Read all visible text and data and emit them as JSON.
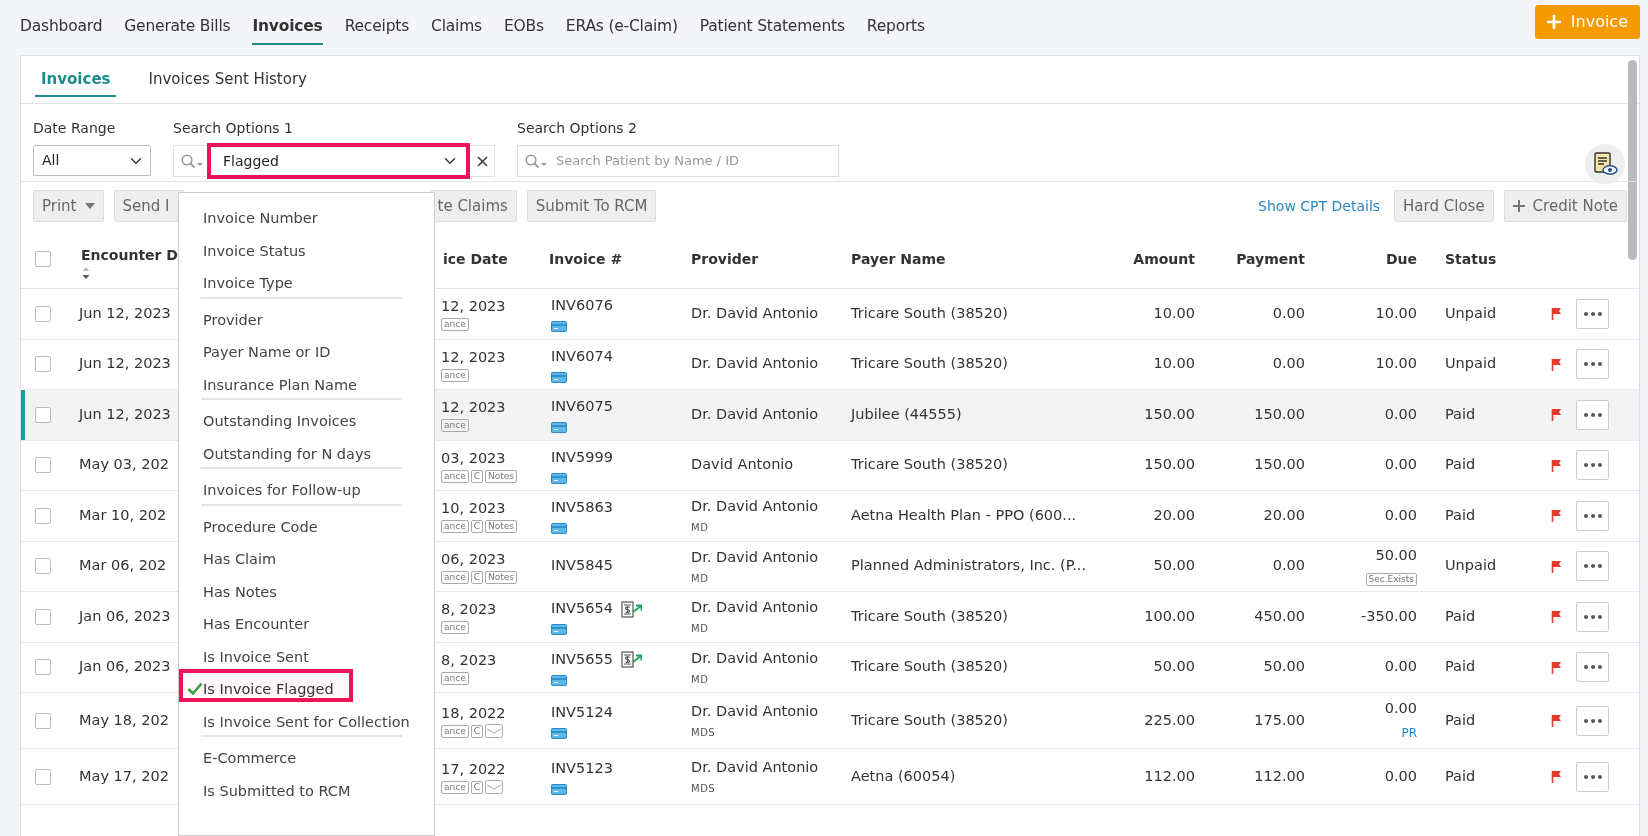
{
  "nav": {
    "tabs": [
      {
        "label": "Dashboard",
        "selected": false
      },
      {
        "label": "Generate Bills",
        "selected": false
      },
      {
        "label": "Invoices",
        "selected": true
      },
      {
        "label": "Receipts",
        "selected": false
      },
      {
        "label": "Claims",
        "selected": false
      },
      {
        "label": "EOBs",
        "selected": false
      },
      {
        "label": "ERAs (e-Claim)",
        "selected": false
      },
      {
        "label": "Patient Statements",
        "selected": false
      },
      {
        "label": "Reports",
        "selected": false
      }
    ],
    "new_button": "Invoice"
  },
  "subtabs": [
    {
      "label": "Invoices",
      "selected": true
    },
    {
      "label": "Invoices Sent History",
      "selected": false
    }
  ],
  "filters": {
    "date_range": {
      "label": "Date Range",
      "value": "All"
    },
    "search1": {
      "label": "Search Options 1",
      "value": "Flagged",
      "highlighted": true
    },
    "search2": {
      "label": "Search Options 2",
      "placeholder": "Search Patient by Name / ID"
    }
  },
  "toolbar": {
    "left": [
      {
        "label": "Print",
        "kind": "dropdown"
      },
      {
        "label": "Send I",
        "kind": "button"
      },
      {
        "label": "te Claims",
        "kind": "button"
      },
      {
        "label": "Submit To RCM",
        "kind": "button"
      }
    ],
    "link": "Show CPT Details",
    "right": [
      {
        "label": "Hard Close",
        "kind": "button"
      },
      {
        "label": "Credit Note",
        "kind": "add"
      }
    ]
  },
  "table": {
    "select_all_checked": false,
    "columns": [
      "Encounter D",
      "ice Date",
      "Invoice #",
      "Provider",
      "Payer Name",
      "Amount",
      "Payment",
      "Due",
      "Status"
    ],
    "rows": [
      {
        "selected": false,
        "checked": false,
        "encounter": "Jun 12, 2023",
        "invoice_date": "12, 2023",
        "tags": [
          "ance"
        ],
        "mail": false,
        "invoice": "INV6076",
        "card": true,
        "sent": false,
        "provider": "Dr. David Antonio",
        "amount": "10.00",
        "payment": "0.00",
        "payer": "Tricare South (38520)",
        "due": "10.00",
        "status": "Unpaid",
        "flagged": true
      },
      {
        "selected": false,
        "checked": false,
        "encounter": "Jun 12, 2023",
        "invoice_date": "12, 2023",
        "tags": [
          "ance"
        ],
        "mail": false,
        "invoice": "INV6074",
        "card": true,
        "sent": false,
        "provider": "Dr. David Antonio",
        "amount": "10.00",
        "payment": "0.00",
        "payer": "Tricare South (38520)",
        "due": "10.00",
        "status": "Unpaid",
        "flagged": true
      },
      {
        "selected": true,
        "checked": false,
        "encounter": "Jun 12, 2023",
        "invoice_date": "12, 2023",
        "tags": [
          "ance"
        ],
        "mail": false,
        "invoice": "INV6075",
        "card": true,
        "sent": false,
        "provider": "Dr. David Antonio",
        "amount": "150.00",
        "payment": "150.00",
        "payer": "Jubilee (44555)",
        "due": "0.00",
        "status": "Paid",
        "flagged": true
      },
      {
        "selected": false,
        "checked": false,
        "encounter": "May 03, 202",
        "invoice_date": "03, 2023",
        "tags": [
          "ance",
          "C",
          "Notes"
        ],
        "mail": false,
        "invoice": "INV5999",
        "card": true,
        "sent": false,
        "provider": "David Antonio",
        "amount": "150.00",
        "payment": "150.00",
        "payer": "Tricare South (38520)",
        "due": "0.00",
        "status": "Paid",
        "flagged": true
      },
      {
        "selected": false,
        "checked": false,
        "encounter": "Mar 10, 202",
        "invoice_date": "10, 2023",
        "tags": [
          "ance",
          "C",
          "Notes"
        ],
        "mail": false,
        "invoice": "INV5863",
        "card": true,
        "sent": false,
        "provider": "Dr. David Antonio",
        "provider_suffix": "MD",
        "amount": "20.00",
        "payment": "20.00",
        "payer": "Aetna Health Plan - PPO (600...",
        "due": "0.00",
        "status": "Paid",
        "flagged": true
      },
      {
        "selected": false,
        "checked": false,
        "encounter": "Mar 06, 202",
        "invoice_date": "06, 2023",
        "tags": [
          "ance",
          "C",
          "Notes"
        ],
        "mail": false,
        "invoice": "INV5845",
        "card": false,
        "sent": false,
        "provider": "Dr. David Antonio",
        "provider_suffix": "MD",
        "amount": "50.00",
        "payment": "0.00",
        "payer": "Planned Administrators, Inc. (P...",
        "due": "50.00",
        "due_note": {
          "kind": "tag",
          "text": "Sec.Exists"
        },
        "status": "Unpaid",
        "flagged": true
      },
      {
        "selected": false,
        "checked": false,
        "encounter": "Jan 06, 2023",
        "invoice_date": "8, 2023",
        "tags": [
          "ance"
        ],
        "mail": false,
        "invoice": "INV5654",
        "card": true,
        "sent": true,
        "provider": "Dr. David Antonio",
        "provider_suffix": "MD",
        "amount": "100.00",
        "payment": "450.00",
        "payer": "Tricare South (38520)",
        "due": "-350.00",
        "status": "Paid",
        "flagged": true
      },
      {
        "selected": false,
        "checked": false,
        "encounter": "Jan 06, 2023",
        "invoice_date": "8, 2023",
        "tags": [
          "ance"
        ],
        "mail": false,
        "invoice": "INV5655",
        "card": true,
        "sent": true,
        "provider": "Dr. David Antonio",
        "provider_suffix": "MD",
        "amount": "50.00",
        "payment": "50.00",
        "payer": "Tricare South (38520)",
        "due": "0.00",
        "status": "Paid",
        "flagged": true
      },
      {
        "selected": false,
        "checked": false,
        "encounter": "May 18, 202",
        "invoice_date": "18, 2022",
        "tags": [
          "ance",
          "C"
        ],
        "mail": true,
        "invoice": "INV5124",
        "card": true,
        "sent": false,
        "provider": "Dr. David Antonio",
        "provider_suffix": "MDS",
        "amount": "225.00",
        "payment": "175.00",
        "payer": "Tricare South (38520)",
        "due": "0.00",
        "due_note": {
          "kind": "link",
          "text": "PR"
        },
        "status": "Paid",
        "flagged": true
      },
      {
        "selected": false,
        "checked": false,
        "encounter": "May 17, 202",
        "invoice_date": "17, 2022",
        "tags": [
          "ance",
          "C"
        ],
        "mail": true,
        "invoice": "INV5123",
        "card": true,
        "sent": false,
        "provider": "Dr. David Antonio",
        "provider_suffix": "MDS",
        "amount": "112.00",
        "payment": "112.00",
        "payer": "Aetna (60054)",
        "due": "0.00",
        "status": "Paid",
        "flagged": true
      }
    ]
  },
  "search_menu": {
    "groups": [
      [
        {
          "label": "Invoice Number",
          "selected": false
        },
        {
          "label": "Invoice Status",
          "selected": false
        },
        {
          "label": "Invoice Type",
          "selected": false
        }
      ],
      [
        {
          "label": "Provider",
          "selected": false
        },
        {
          "label": "Payer Name or ID",
          "selected": false
        },
        {
          "label": "Insurance Plan Name",
          "selected": false
        }
      ],
      [
        {
          "label": "Outstanding Invoices",
          "selected": false
        },
        {
          "label": "Outstanding for N days",
          "selected": false
        }
      ],
      [
        {
          "label": "Invoices for Follow-up",
          "selected": false
        }
      ],
      [
        {
          "label": "Procedure Code",
          "selected": false
        },
        {
          "label": "Has Claim",
          "selected": false
        },
        {
          "label": "Has Notes",
          "selected": false
        },
        {
          "label": "Has Encounter",
          "selected": false
        },
        {
          "label": "Is Invoice Sent",
          "selected": false
        },
        {
          "label": "Is Invoice Flagged",
          "selected": true
        },
        {
          "label": "Is Invoice Sent for Collection",
          "selected": false
        }
      ],
      [
        {
          "label": "E-Commerce",
          "selected": false
        },
        {
          "label": "Is Submitted to RCM",
          "selected": false
        }
      ]
    ]
  }
}
